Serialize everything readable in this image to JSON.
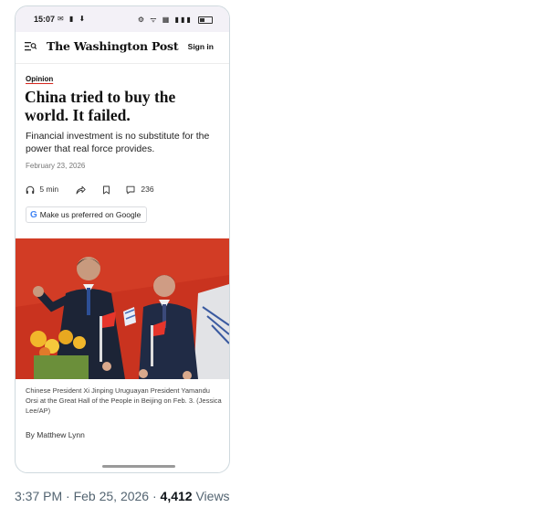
{
  "statusbar": {
    "time": "15:07",
    "left_icons": "✉ ▮ ⬇",
    "right_icons": "⚙ ᯤ ▦ ▮▮▮"
  },
  "navbar": {
    "logo": "The Washington Post",
    "signin_label": "Sign in"
  },
  "article": {
    "section": "Opinion",
    "headline": "China tried to buy the world. It failed.",
    "dek": "Financial investment is no substitute for the power that real force provides.",
    "date": "February 23, 2026",
    "listen_label": "5 min",
    "comment_count": "236",
    "preferred_button_label": "Make us preferred on Google",
    "photo_caption": "Chinese President Xi Jinping Uruguayan President Yamandu Orsi at the Great Hall of the People in Beijing on Feb. 3. (Jessica Lee/AP)",
    "byline": "By Matthew Lynn"
  },
  "icons": {
    "menu": "menu-search-icon",
    "listen": "headphones-icon",
    "share": "share-icon",
    "save": "bookmark-icon",
    "comments": "comment-icon",
    "google": "google-g-icon"
  },
  "tweet": {
    "timestamp": "3:37 PM · Feb 25, 2026 · ",
    "views_count": "4,412",
    "views_label": " Views"
  },
  "colors": {
    "accent_red": "#d6261e",
    "carpet_red": "#c9331f",
    "meta_gray": "#536471"
  }
}
